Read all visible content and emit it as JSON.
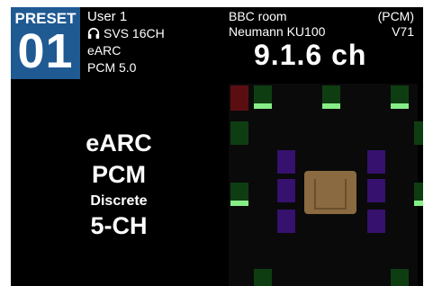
{
  "preset": {
    "label": "PRESET",
    "number": "01"
  },
  "user": "User 1",
  "headphone": {
    "icon": "headphones-icon",
    "name": "SVS 16CH"
  },
  "source": "eARC",
  "codec_info": "PCM  5.0",
  "room": "BBC room",
  "mic": "Neumann KU100",
  "pcm_tag": "(PCM)",
  "version": "V71",
  "speaker_format": "9.1.6 ch",
  "input": {
    "line1": "eARC",
    "line2": "PCM",
    "line3": "Discrete",
    "line4": "5-CH"
  },
  "colors": {
    "preset_bg": "#1f5a93",
    "speaker_off": "#0f3d12",
    "speaker_active_bar": "#86ee86",
    "lfe": "#5a0e12",
    "height": "#36116e",
    "listener": "#8a6a40"
  }
}
